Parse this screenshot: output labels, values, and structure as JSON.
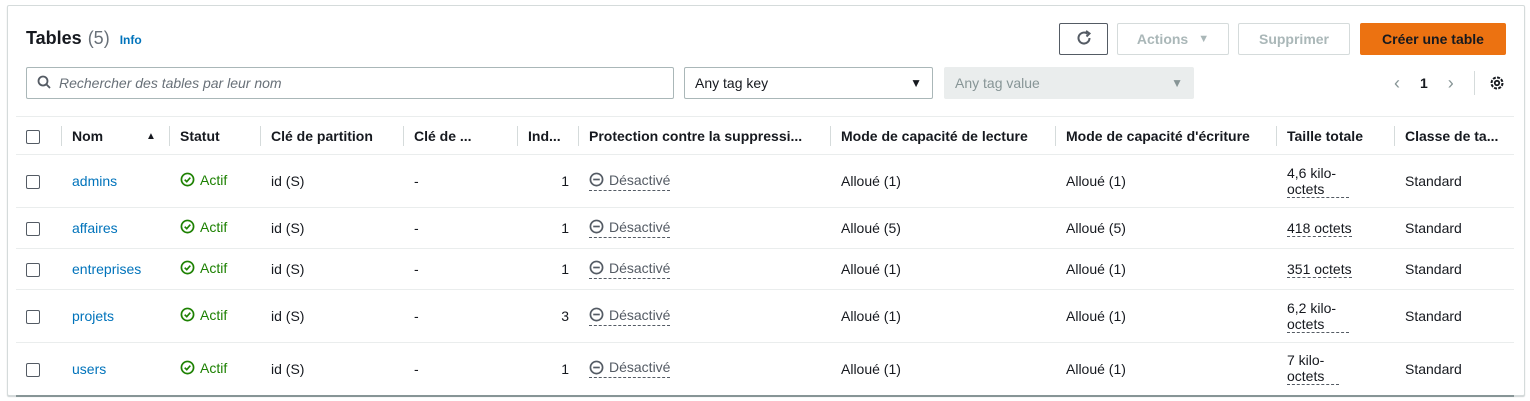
{
  "header": {
    "title": "Tables",
    "count": "(5)",
    "info": "Info"
  },
  "toolbar": {
    "actions_label": "Actions",
    "delete_label": "Supprimer",
    "create_label": "Créer une table"
  },
  "search": {
    "placeholder": "Rechercher des tables par leur nom",
    "value": ""
  },
  "filters": {
    "tag_key": {
      "selected": "Any tag key"
    },
    "tag_value": {
      "placeholder": "Any tag value"
    }
  },
  "pagination": {
    "current_page": "1"
  },
  "table": {
    "columns": [
      "Nom",
      "Statut",
      "Clé de partition",
      "Clé de ...",
      "Ind...",
      "Protection contre la suppressi...",
      "Mode de capacité de lecture",
      "Mode de capacité d'écriture",
      "Taille totale",
      "Classe de ta..."
    ],
    "rows": [
      {
        "name": "admins",
        "status": "Actif",
        "partition_key": "id (S)",
        "sort_key": "-",
        "indexes": "1",
        "protection": "Désactivé",
        "read_mode": "Alloué (1)",
        "write_mode": "Alloué (1)",
        "size": "4,6 kilo-octets",
        "class": "Standard"
      },
      {
        "name": "affaires",
        "status": "Actif",
        "partition_key": "id (S)",
        "sort_key": "-",
        "indexes": "1",
        "protection": "Désactivé",
        "read_mode": "Alloué (5)",
        "write_mode": "Alloué (5)",
        "size": "418 octets",
        "class": "Standard"
      },
      {
        "name": "entreprises",
        "status": "Actif",
        "partition_key": "id (S)",
        "sort_key": "-",
        "indexes": "1",
        "protection": "Désactivé",
        "read_mode": "Alloué (1)",
        "write_mode": "Alloué (1)",
        "size": "351 octets",
        "class": "Standard"
      },
      {
        "name": "projets",
        "status": "Actif",
        "partition_key": "id (S)",
        "sort_key": "-",
        "indexes": "3",
        "protection": "Désactivé",
        "read_mode": "Alloué (1)",
        "write_mode": "Alloué (1)",
        "size": "6,2 kilo-octets",
        "class": "Standard"
      },
      {
        "name": "users",
        "status": "Actif",
        "partition_key": "id (S)",
        "sort_key": "-",
        "indexes": "1",
        "protection": "Désactivé",
        "read_mode": "Alloué (1)",
        "write_mode": "Alloué (1)",
        "size": "7 kilo-octets",
        "class": "Standard"
      }
    ]
  },
  "colors": {
    "accent": "#ec7211",
    "link": "#0073bb",
    "success": "#1d8102",
    "muted": "#687078",
    "disabled": "#aab7b8"
  },
  "icons": {
    "refresh": "refresh-icon",
    "search": "search-icon",
    "settings": "gear-icon",
    "status": "check-circle-icon",
    "protection": "minus-circle-icon"
  }
}
